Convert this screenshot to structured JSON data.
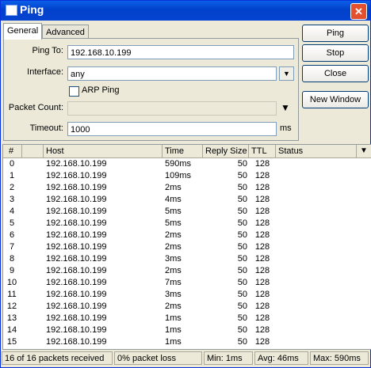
{
  "window": {
    "title": "Ping",
    "close_glyph": "✕"
  },
  "tabs": [
    {
      "label": "General"
    },
    {
      "label": "Advanced"
    }
  ],
  "form": {
    "ping_to_label": "Ping To:",
    "ping_to_value": "192.168.10.199",
    "interface_label": "Interface:",
    "interface_value": "any",
    "arp_ping_label": "ARP Ping",
    "arp_ping_checked": false,
    "packet_count_label": "Packet Count:",
    "packet_count_value": "",
    "timeout_label": "Timeout:",
    "timeout_value": "1000",
    "timeout_unit": "ms"
  },
  "buttons": {
    "ping": "Ping",
    "stop": "Stop",
    "close": "Close",
    "new_window": "New Window"
  },
  "table": {
    "columns": [
      "#",
      "Host",
      "Time",
      "Reply Size",
      "TTL",
      "Status"
    ],
    "rows": [
      {
        "n": "0",
        "host": "192.168.10.199",
        "time": "590ms",
        "size": "50",
        "ttl": "128",
        "status": ""
      },
      {
        "n": "1",
        "host": "192.168.10.199",
        "time": "109ms",
        "size": "50",
        "ttl": "128",
        "status": ""
      },
      {
        "n": "2",
        "host": "192.168.10.199",
        "time": "2ms",
        "size": "50",
        "ttl": "128",
        "status": ""
      },
      {
        "n": "3",
        "host": "192.168.10.199",
        "time": "4ms",
        "size": "50",
        "ttl": "128",
        "status": ""
      },
      {
        "n": "4",
        "host": "192.168.10.199",
        "time": "5ms",
        "size": "50",
        "ttl": "128",
        "status": ""
      },
      {
        "n": "5",
        "host": "192.168.10.199",
        "time": "5ms",
        "size": "50",
        "ttl": "128",
        "status": ""
      },
      {
        "n": "6",
        "host": "192.168.10.199",
        "time": "2ms",
        "size": "50",
        "ttl": "128",
        "status": ""
      },
      {
        "n": "7",
        "host": "192.168.10.199",
        "time": "2ms",
        "size": "50",
        "ttl": "128",
        "status": ""
      },
      {
        "n": "8",
        "host": "192.168.10.199",
        "time": "3ms",
        "size": "50",
        "ttl": "128",
        "status": ""
      },
      {
        "n": "9",
        "host": "192.168.10.199",
        "time": "2ms",
        "size": "50",
        "ttl": "128",
        "status": ""
      },
      {
        "n": "10",
        "host": "192.168.10.199",
        "time": "7ms",
        "size": "50",
        "ttl": "128",
        "status": ""
      },
      {
        "n": "11",
        "host": "192.168.10.199",
        "time": "3ms",
        "size": "50",
        "ttl": "128",
        "status": ""
      },
      {
        "n": "12",
        "host": "192.168.10.199",
        "time": "2ms",
        "size": "50",
        "ttl": "128",
        "status": ""
      },
      {
        "n": "13",
        "host": "192.168.10.199",
        "time": "1ms",
        "size": "50",
        "ttl": "128",
        "status": ""
      },
      {
        "n": "14",
        "host": "192.168.10.199",
        "time": "1ms",
        "size": "50",
        "ttl": "128",
        "status": ""
      },
      {
        "n": "15",
        "host": "192.168.10.199",
        "time": "1ms",
        "size": "50",
        "ttl": "128",
        "status": ""
      }
    ]
  },
  "status_bar": {
    "received": "16 of 16 packets received",
    "loss": "0% packet loss",
    "min": "Min: 1ms",
    "avg": "Avg: 46ms",
    "max": "Max: 590ms"
  },
  "colors": {
    "titlebar": "#0a5fe8",
    "window_bg": "#ece9d8",
    "close": "#e3502d"
  },
  "icons": {
    "window": "window-icon",
    "close": "close-icon",
    "dropdown": "dropdown-arrow-icon",
    "column_menu": "column-menu-icon"
  }
}
